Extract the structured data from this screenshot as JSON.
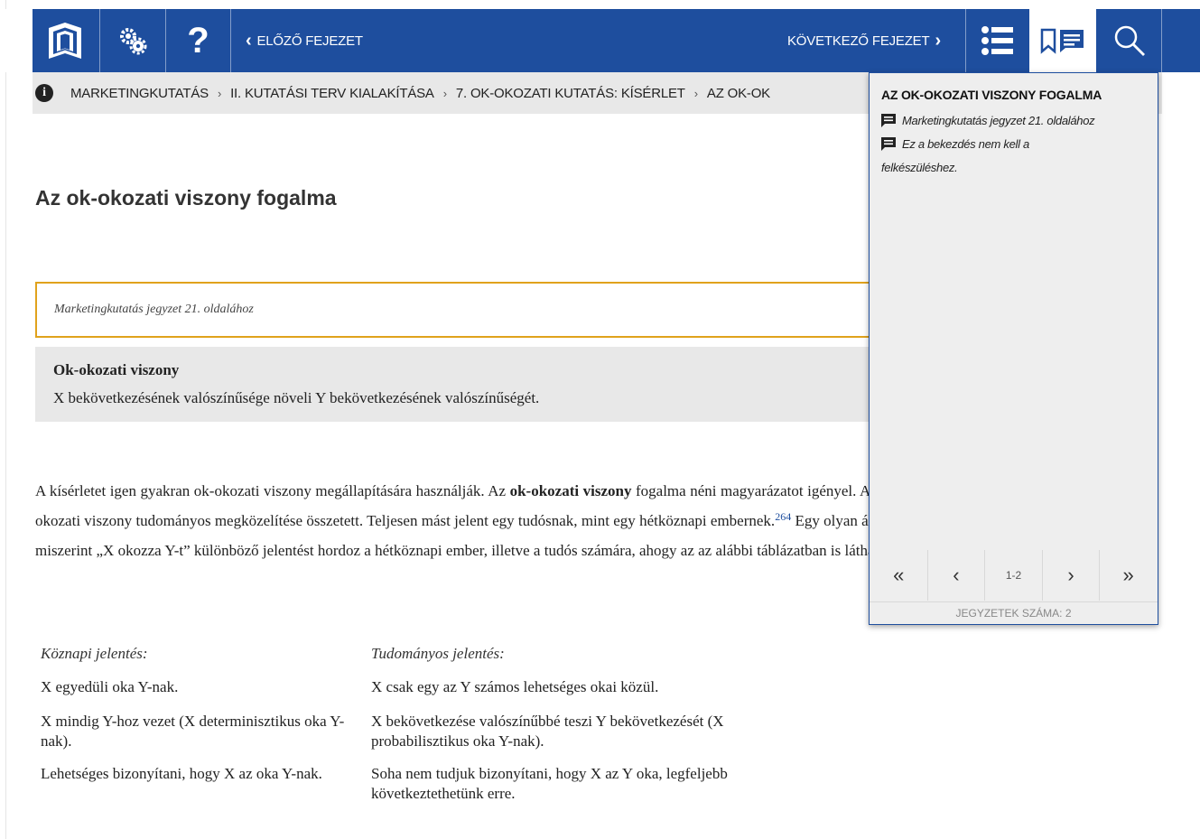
{
  "toolbar": {
    "prev_label": "ELŐZŐ FEJEZET",
    "next_label": "KÖVETKEZŐ FEJEZET",
    "help_glyph": "?",
    "icons": [
      "book-logo-icon",
      "gears-icon",
      "question-icon",
      "list-icon",
      "bookmark-notes-icon",
      "search-icon"
    ],
    "colors": {
      "bar": "#1e4e9e",
      "accent_border": "#e0a21c"
    }
  },
  "breadcrumb": {
    "items": [
      "MARKETINGKUTATÁS",
      "II. KUTATÁSI TERV KIALAKÍTÁSA",
      "7. OK-OKOZATI KUTATÁS: KÍSÉRLET",
      "AZ OK-OK"
    ],
    "separator": "›"
  },
  "main": {
    "title": "Az ok-okozati viszony fogalma",
    "note_box": "Marketingkutatás jegyzet 21. oldalához",
    "definition": {
      "title": "Ok-okozati viszony",
      "text": "X bekövetkezésének valószínűsége növeli Y bekövetkezésének valószínűségét."
    },
    "paragraph": {
      "part1": "A kísérletet igen gyakran ok-okozati viszony megállapítására használják. Az ",
      "bold": "ok-okozati viszony",
      "part2": " fogalma néni magyarázatot igényel. Az ok-okozati viszony tudományos megközelítése összetett. Teljesen mást jelent egy tudósnak, mint egy hétköznapi embernek.",
      "footnote": "264",
      "part3": " Egy olyan állítás, miszerint „X okozza Y-t” különböző jelentést hordoz a hétköznapi ember, illetve a tudós számára, ahogy az az alábbi táblázatban is látható."
    },
    "table": {
      "headers": [
        "Köznapi jelentés:",
        "Tudományos jelentés:"
      ],
      "rows": [
        [
          "X egyedüli oka Y-nak.",
          "X csak egy az Y számos lehetséges okai közül."
        ],
        [
          "X mindig Y-hoz vezet (X determinisztikus oka Y-nak).",
          "X bekövetkezése valószínűbbé teszi Y bekövetkezését (X probabilisztikus oka Y-nak)."
        ],
        [
          "Lehetséges bizonyítani, hogy X az oka Y-nak.",
          "Soha nem tudjuk bizonyítani, hogy X az Y oka, legfeljebb következtethetünk erre."
        ]
      ]
    }
  },
  "notes_panel": {
    "title": "AZ OK-OKOZATI VISZONY FOGALMA",
    "notes": [
      "Marketingkutatás jegyzet 21. oldalához",
      "Ez a bekezdés nem kell a felkészüléshez."
    ],
    "pager": {
      "first": "«",
      "prev": "‹",
      "page": "1-2",
      "next": "›",
      "last": "»"
    },
    "count_label": "JEGYZETEK SZÁMA: 2"
  }
}
